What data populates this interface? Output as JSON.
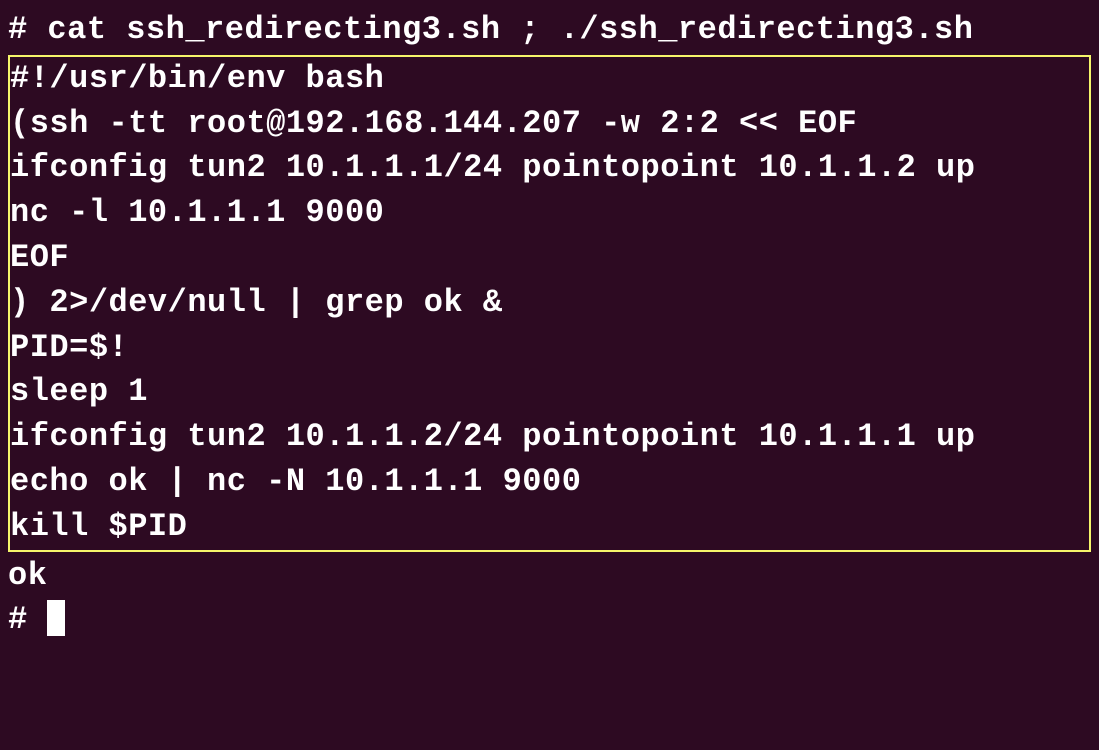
{
  "terminal": {
    "command_line": "# cat ssh_redirecting3.sh ; ./ssh_redirecting3.sh",
    "script_lines": [
      "#!/usr/bin/env bash",
      "",
      "(ssh -tt root@192.168.144.207 -w 2:2 << EOF",
      "ifconfig tun2 10.1.1.1/24 pointopoint 10.1.1.2 up",
      "nc -l 10.1.1.1 9000",
      "EOF",
      ") 2>/dev/null | grep ok &",
      "PID=$!",
      "",
      "sleep 1",
      "ifconfig tun2 10.1.1.2/24 pointopoint 10.1.1.1 up",
      "echo ok | nc -N 10.1.1.1 9000",
      "kill $PID"
    ],
    "output_line": "ok",
    "next_prompt": "# "
  }
}
